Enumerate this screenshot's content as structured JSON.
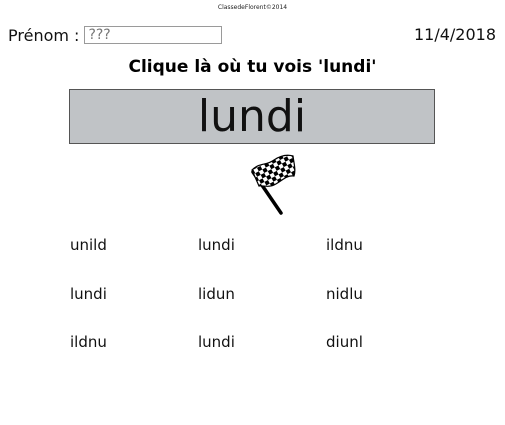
{
  "copyright": "ClassedeFlorent©2014",
  "student": {
    "label": "Prénom :",
    "value": "???"
  },
  "date": "11/4/2018",
  "instruction": "Clique là où tu vois 'lundi'",
  "target_word": "lundi",
  "choices": [
    [
      "unild",
      "lundi",
      "ildnu"
    ],
    [
      "lundi",
      "lidun",
      "nidlu"
    ],
    [
      "ildnu",
      "lundi",
      "diunl"
    ]
  ]
}
